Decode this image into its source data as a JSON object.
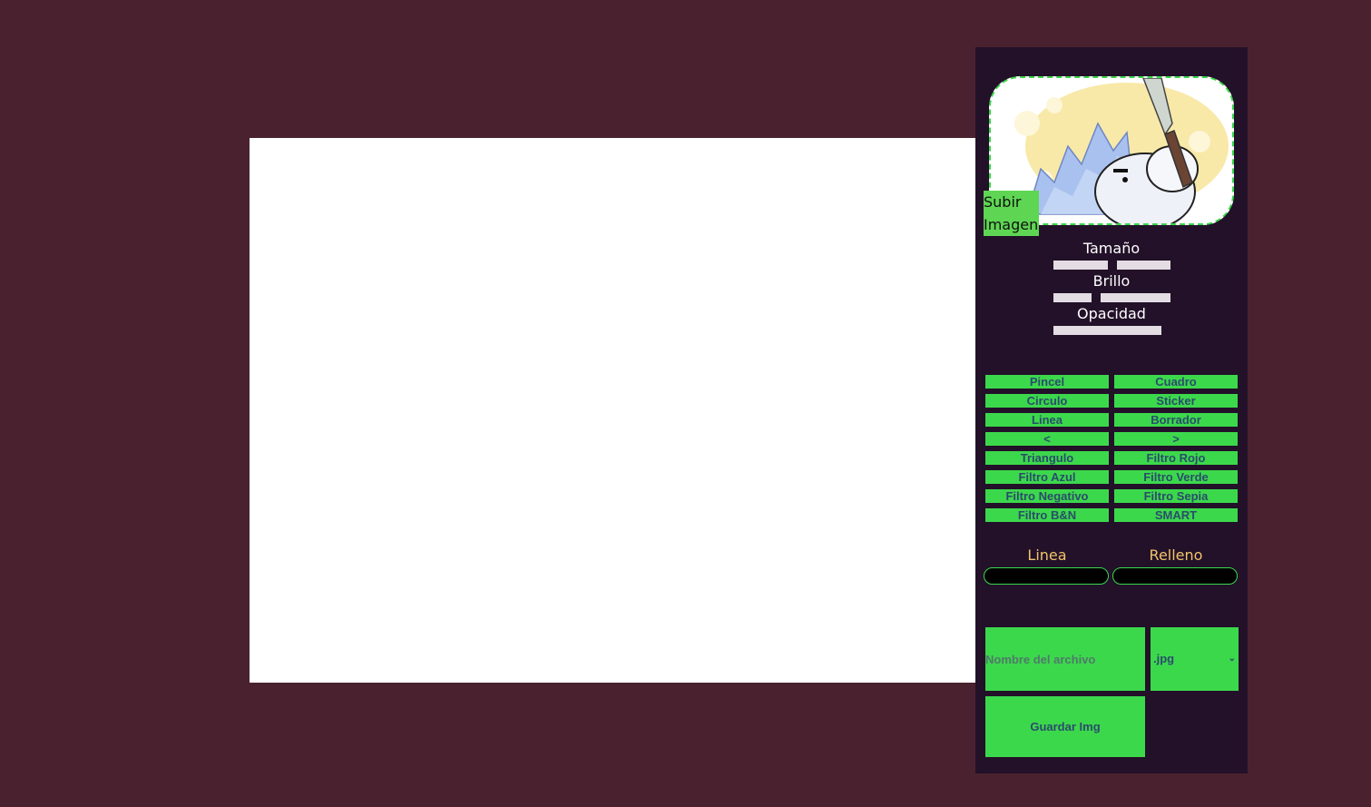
{
  "upload": {
    "label_line1": "Subir",
    "label_line2": "Imagen"
  },
  "sliders": {
    "size": {
      "label": "Tamaño",
      "value_percent": 50
    },
    "brightness": {
      "label": "Brillo",
      "value_percent": 35
    },
    "opacity": {
      "label": "Opacidad",
      "value_percent": 100
    }
  },
  "tools": [
    {
      "label": "Pincel"
    },
    {
      "label": "Cuadro"
    },
    {
      "label": "Circulo"
    },
    {
      "label": "Sticker"
    },
    {
      "label": "Linea"
    },
    {
      "label": "Borrador"
    },
    {
      "label": "<"
    },
    {
      "label": ">"
    },
    {
      "label": "Triangulo"
    },
    {
      "label": "Filtro Rojo"
    },
    {
      "label": "Filtro Azul"
    },
    {
      "label": "Filtro Verde"
    },
    {
      "label": "Filtro Negativo"
    },
    {
      "label": "Filtro Sepia"
    },
    {
      "label": "Filtro B&N"
    },
    {
      "label": "SMART"
    }
  ],
  "colors": {
    "line_label": "Linea",
    "line_value": "#000000",
    "fill_label": "Relleno",
    "fill_value": "#000000"
  },
  "save": {
    "filename_placeholder": "Nombre del archivo",
    "format_selected": ".jpg",
    "button_label": "Guardar Img"
  },
  "theme": {
    "background": "#4a222f",
    "panel": "#221128",
    "accent": "#3cd84c"
  }
}
